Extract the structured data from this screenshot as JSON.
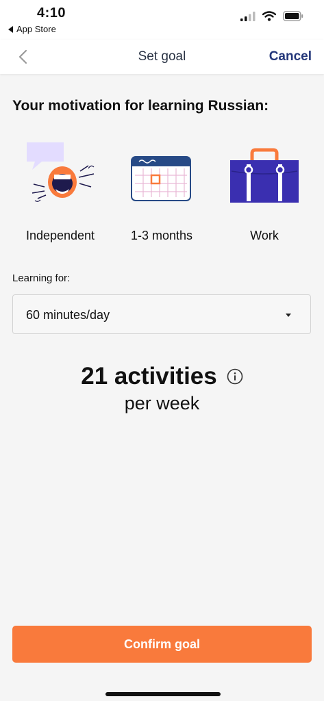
{
  "status_bar": {
    "time": "4:10",
    "back_app": "App Store"
  },
  "nav": {
    "title": "Set goal",
    "cancel_label": "Cancel"
  },
  "heading": "Your motivation for learning Russian:",
  "motivation": [
    {
      "label": "Independent",
      "icon": "speaking-mouth-icon"
    },
    {
      "label": "1-3 months",
      "icon": "calendar-icon"
    },
    {
      "label": "Work",
      "icon": "briefcase-icon"
    }
  ],
  "learning": {
    "label": "Learning for:",
    "selected": "60 minutes/day"
  },
  "activities": {
    "count_text": "21 activities",
    "period": "per week"
  },
  "confirm_label": "Confirm goal",
  "colors": {
    "accent_orange": "#f97a3c",
    "nav_blue": "#24377a",
    "briefcase_blue": "#3a2fb0",
    "calendar_header": "#274a86",
    "speech_bubble": "#e3dcff"
  }
}
